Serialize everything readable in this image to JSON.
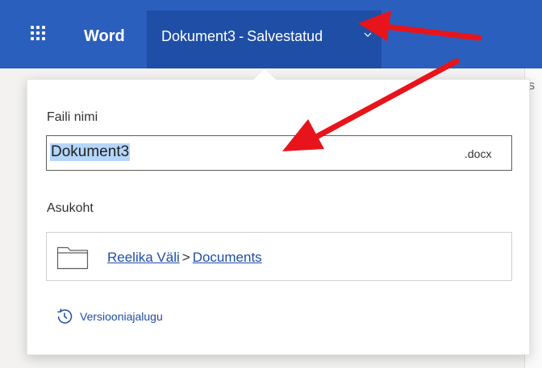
{
  "app": {
    "name": "Word",
    "document_name": "Dokument3",
    "separator": "-",
    "save_status": "Salvestatud"
  },
  "panel": {
    "filename_label": "Faili nimi",
    "filename_value": "Dokument3",
    "extension": ".docx",
    "location_label": "Asukoht",
    "location_owner": "Reelika Väli",
    "location_separator": ">",
    "location_folder": "Documents",
    "history_link": "Versiooniajalugu"
  },
  "background": {
    "right_partial_text": "S"
  },
  "colors": {
    "accent": "#2b5fbd",
    "accent_dark": "#1f4ea6",
    "selection": "#b4d6fa",
    "annotation": "#e8141b"
  }
}
